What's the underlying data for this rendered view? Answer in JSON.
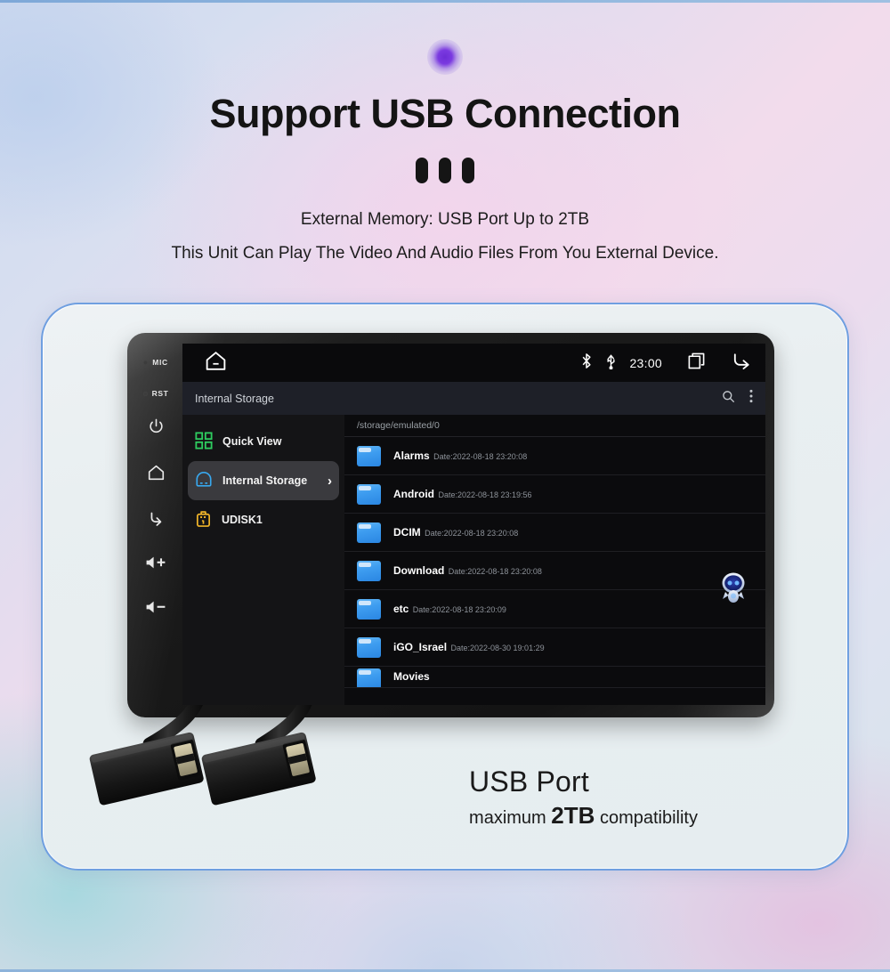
{
  "page": {
    "title": "Support USB Connection",
    "subtitle_1": "External Memory: USB Port Up to 2TB",
    "subtitle_2": "This Unit Can Play The Video And Audio Files From You External Device."
  },
  "usb_caption": {
    "line1": "USB Port",
    "line2_prefix": "maximum ",
    "line2_highlight": "2TB",
    "line2_suffix": " compatibility"
  },
  "device": {
    "side_buttons": [
      {
        "name": "mic-indicator",
        "label": "MIC"
      },
      {
        "name": "reset-indicator",
        "label": "RST"
      },
      {
        "name": "power-button",
        "label": ""
      },
      {
        "name": "home-button",
        "label": ""
      },
      {
        "name": "back-button",
        "label": ""
      },
      {
        "name": "volume-up-button",
        "label": ""
      },
      {
        "name": "volume-down-button",
        "label": ""
      }
    ]
  },
  "statusbar": {
    "home_icon": "home-icon",
    "bluetooth_icon": "bluetooth-icon",
    "usb_icon": "usb-icon",
    "clock": "23:00",
    "recents_icon": "recent-apps-icon",
    "back_icon": "back-arrow-icon"
  },
  "appbar": {
    "title": "Internal Storage",
    "search_icon": "search-icon",
    "overflow_icon": "more-vertical-icon"
  },
  "sidebar": {
    "items": [
      {
        "label": "Quick View",
        "icon": "grid-icon",
        "selected": false
      },
      {
        "label": "Internal Storage",
        "icon": "hard-drive-icon",
        "selected": true
      },
      {
        "label": "UDISK1",
        "icon": "usb-drive-icon",
        "selected": false
      }
    ],
    "chevron": "›"
  },
  "files": {
    "breadcrumb": "/storage/emulated/0",
    "date_prefix": "Date:",
    "rows": [
      {
        "name": "Alarms",
        "date": "Date:2022-08-18 23:20:08"
      },
      {
        "name": "Android",
        "date": "Date:2022-08-18 23:19:56"
      },
      {
        "name": "DCIM",
        "date": "Date:2022-08-18 23:20:08"
      },
      {
        "name": "Download",
        "date": "Date:2022-08-18 23:20:08"
      },
      {
        "name": "etc",
        "date": "Date:2022-08-18 23:20:09"
      },
      {
        "name": "iGO_Israel",
        "date": "Date:2022-08-30 19:01:29"
      },
      {
        "name": "Movies",
        "date": ""
      }
    ],
    "mascot_icon": "robot-assistant-icon"
  },
  "colors": {
    "accent_blue": "#3e9df0",
    "quick_view_green": "#2ecc5f",
    "udisk_yellow": "#f0b429",
    "card_border": "#6f9fe0",
    "glow_dot": "#7b3ae0"
  }
}
